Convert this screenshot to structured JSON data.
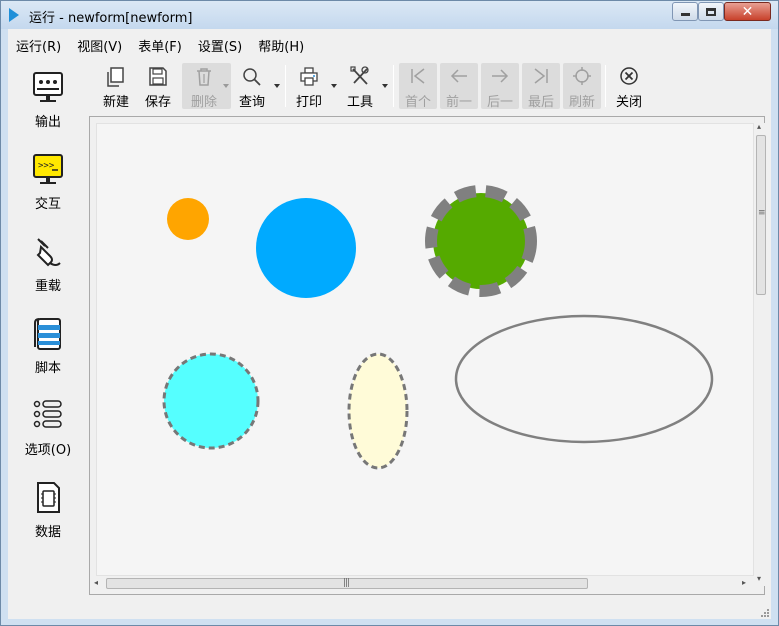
{
  "window": {
    "title": "运行 - newform[newform]",
    "close_glyph": "✕"
  },
  "menu": {
    "items": [
      {
        "label": "运行(R)"
      },
      {
        "label": "视图(V)"
      },
      {
        "label": "表单(F)"
      },
      {
        "label": "设置(S)"
      },
      {
        "label": "帮助(H)"
      }
    ]
  },
  "sidebar": {
    "items": [
      {
        "label": "输出",
        "icon": "monitor-icon"
      },
      {
        "label": "交互",
        "icon": "terminal-icon"
      },
      {
        "label": "重载",
        "icon": "plug-icon"
      },
      {
        "label": "脚本",
        "icon": "script-icon"
      },
      {
        "label": "选项(O)",
        "icon": "options-list-icon"
      },
      {
        "label": "数据",
        "icon": "data-icon"
      }
    ]
  },
  "toolbar": {
    "new_label": "新建",
    "save_label": "保存",
    "delete_label": "删除",
    "query_label": "查询",
    "print_label": "打印",
    "tools_label": "工具",
    "first_label": "首个",
    "prev_label": "前一",
    "next_label": "后一",
    "last_label": "最后",
    "refresh_label": "刷新",
    "close_label": "关闭"
  },
  "canvas": {
    "shapes": [
      {
        "kind": "circle",
        "name": "small-orange-circle",
        "fill": "#ffa500",
        "outline": "none"
      },
      {
        "kind": "circle",
        "name": "blue-circle",
        "fill": "#00aaff",
        "outline": "none"
      },
      {
        "kind": "circle",
        "name": "green-circle",
        "fill": "#55aa00",
        "outline": "thick-dashed-gray"
      },
      {
        "kind": "circle",
        "name": "cyan-circle",
        "fill": "#55ffff",
        "outline": "dashed-gray"
      },
      {
        "kind": "ellipse",
        "name": "cream-ellipse",
        "fill": "#fffbd8",
        "outline": "dashed-gray"
      },
      {
        "kind": "ellipse",
        "name": "outline-ellipse",
        "fill": "none",
        "outline": "solid-gray"
      }
    ]
  },
  "scrollbars": {
    "left_arrow": "◂",
    "right_arrow": "▸",
    "up_arrow": "▴",
    "down_arrow": "▾",
    "grip": "|||",
    "vgrip": "≡"
  },
  "colors": {
    "chrome": "#cfe0f1",
    "accent": "#1f8fd8",
    "shape_stroke": "#808080"
  }
}
